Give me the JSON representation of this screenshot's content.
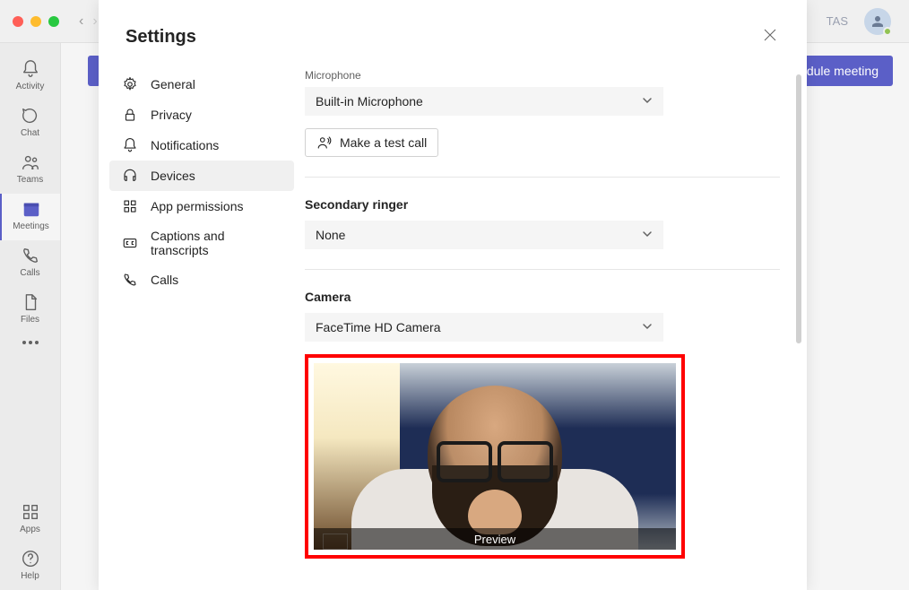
{
  "titlebar": {
    "user_initials": "TAS"
  },
  "rail": {
    "activity": "Activity",
    "chat": "Chat",
    "teams": "Teams",
    "meetings": "Meetings",
    "calls": "Calls",
    "files": "Files",
    "apps": "Apps",
    "help": "Help"
  },
  "topbar": {
    "schedule_meeting": "dule meeting"
  },
  "settings": {
    "title": "Settings",
    "nav": {
      "general": "General",
      "privacy": "Privacy",
      "notifications": "Notifications",
      "devices": "Devices",
      "app_permissions": "App permissions",
      "captions": "Captions and transcripts",
      "calls": "Calls"
    },
    "devices": {
      "microphone_label": "Microphone",
      "microphone_value": "Built-in Microphone",
      "test_call": "Make a test call",
      "secondary_ringer_head": "Secondary ringer",
      "secondary_ringer_value": "None",
      "camera_head": "Camera",
      "camera_value": "FaceTime HD Camera",
      "preview_label": "Preview"
    }
  }
}
